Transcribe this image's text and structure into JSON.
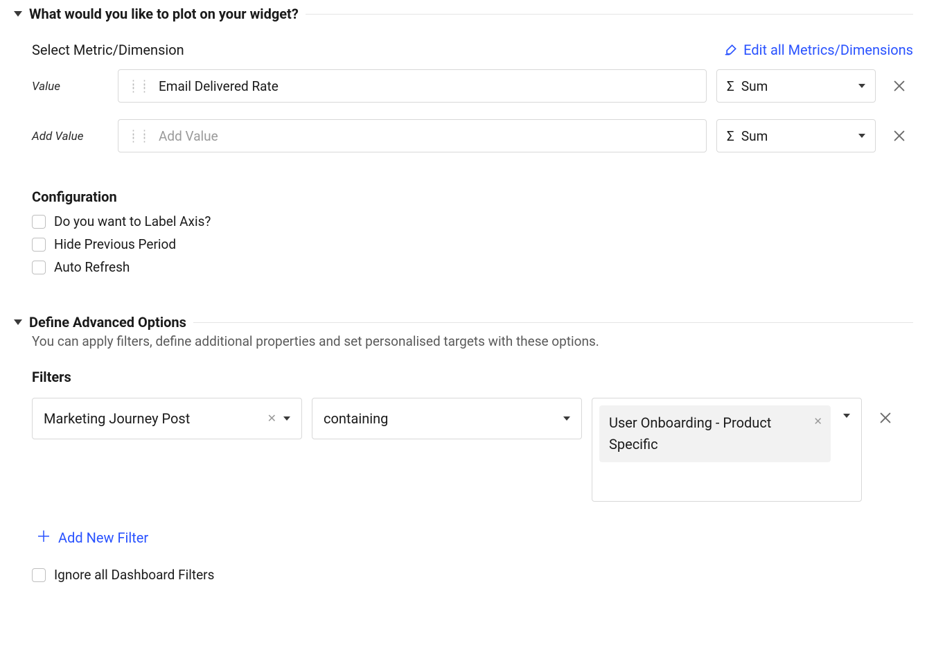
{
  "sections": {
    "plot": {
      "title": "What would you like to plot on your widget?",
      "select_label": "Select Metric/Dimension",
      "edit_link": "Edit all Metrics/Dimensions",
      "rows": [
        {
          "side": "Value",
          "value": "Email Delivered Rate",
          "agg": "Sum"
        },
        {
          "side": "Add Value",
          "placeholder": "Add Value",
          "agg": "Sum"
        }
      ]
    },
    "config": {
      "title": "Configuration",
      "options": [
        "Do you want to Label Axis?",
        "Hide Previous Period",
        "Auto Refresh"
      ]
    },
    "advanced": {
      "title": "Define Advanced Options",
      "subtitle": "You can apply filters, define additional properties and set personalised targets with these options.",
      "filters_title": "Filters",
      "filter": {
        "field": "Marketing Journey Post",
        "operator": "containing",
        "value": "User Onboarding - Product Specific"
      },
      "add_filter": "Add New Filter",
      "ignore": "Ignore all Dashboard Filters"
    }
  },
  "glyphs": {
    "sigma": "Σ"
  }
}
